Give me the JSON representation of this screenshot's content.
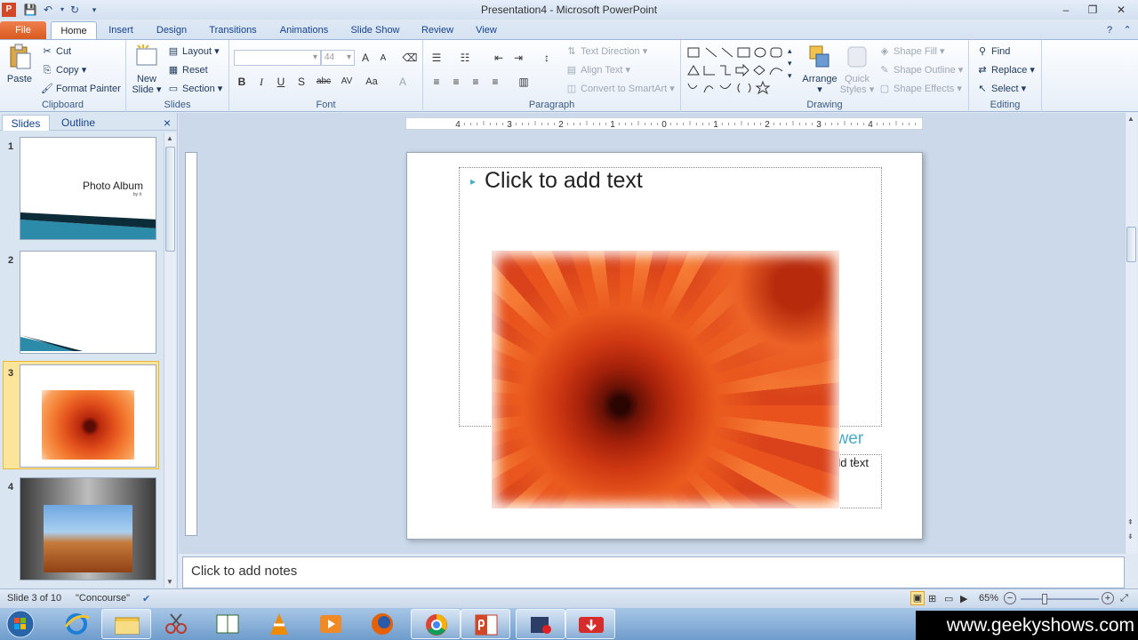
{
  "window": {
    "title": "Presentation4  -  Microsoft PowerPoint"
  },
  "tabs": [
    "File",
    "Home",
    "Insert",
    "Design",
    "Transitions",
    "Animations",
    "Slide Show",
    "Review",
    "View"
  ],
  "clipboard": {
    "paste": "Paste",
    "cut": "Cut",
    "copy": "Copy",
    "format_painter": "Format Painter",
    "label": "Clipboard"
  },
  "slides_group": {
    "new_slide_1": "New",
    "new_slide_2": "Slide",
    "layout": "Layout",
    "reset": "Reset",
    "section": "Section",
    "label": "Slides"
  },
  "font": {
    "size": "44",
    "label": "Font",
    "bold": "B",
    "italic": "I",
    "underline": "U",
    "shadow": "S",
    "strike": "abc",
    "spacing": "AV",
    "case": "Aa",
    "grow": "A",
    "shrink": "A"
  },
  "paragraph": {
    "text_direction": "Text Direction",
    "align_text": "Align Text",
    "smartart": "Convert to SmartArt",
    "label": "Paragraph"
  },
  "drawing": {
    "arrange": "Arrange",
    "quick_styles_1": "Quick",
    "quick_styles_2": "Styles",
    "shape_fill": "Shape Fill",
    "shape_outline": "Shape Outline",
    "shape_effects": "Shape Effects",
    "label": "Drawing"
  },
  "editing": {
    "find": "Find",
    "replace": "Replace",
    "select": "Select",
    "label": "Editing"
  },
  "pane": {
    "tabs": [
      "Slides",
      "Outline"
    ],
    "close": "×",
    "thumbs": [
      {
        "num": "1",
        "title": "Photo Album",
        "sub": "by it"
      },
      {
        "num": "2"
      },
      {
        "num": "3"
      },
      {
        "num": "4"
      }
    ]
  },
  "slide": {
    "body_placeholder": "Click to add text",
    "caption_title_fragment": "ower",
    "caption_text_fragment": "dd text"
  },
  "notes": {
    "placeholder": "Click to add notes"
  },
  "status": {
    "slide": "Slide 3 of 10",
    "theme": "\"Concourse\"",
    "zoom": "65%"
  },
  "ruler": {
    "labels": [
      "4",
      "3",
      "2",
      "1",
      "0",
      "1",
      "2",
      "3",
      "4"
    ]
  },
  "watermark": "www.geekyshows.com",
  "colors": {
    "file_tab": "#e8692f",
    "accent": "#4bacc6",
    "selection": "#f7d35e"
  }
}
